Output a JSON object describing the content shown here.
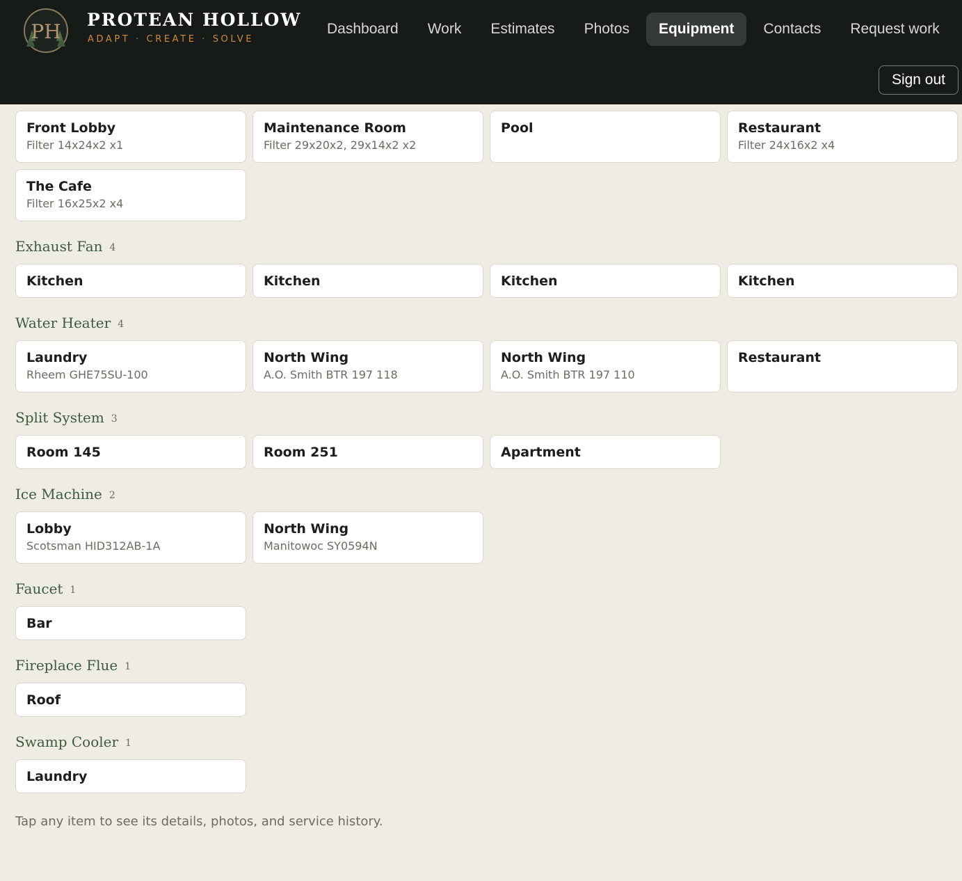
{
  "brand": {
    "name": "PROTEAN HOLLOW",
    "tagline": "ADAPT · CREATE · SOLVE",
    "logo_letters": "PH"
  },
  "nav": {
    "items": [
      "Dashboard",
      "Work",
      "Estimates",
      "Photos",
      "Equipment",
      "Contacts",
      "Request work"
    ],
    "active": "Equipment",
    "sign_out": "Sign out"
  },
  "top_cards": [
    {
      "title": "Front Lobby",
      "sub": "Filter 14x24x2 x1"
    },
    {
      "title": "Maintenance Room",
      "sub": "Filter 29x20x2, 29x14x2 x2"
    },
    {
      "title": "Pool",
      "sub": ""
    },
    {
      "title": "Restaurant",
      "sub": "Filter 24x16x2 x4"
    },
    {
      "title": "The Cafe",
      "sub": "Filter 16x25x2 x4"
    }
  ],
  "sections": [
    {
      "title": "Exhaust Fan",
      "count": "4",
      "items": [
        {
          "title": "Kitchen",
          "sub": ""
        },
        {
          "title": "Kitchen",
          "sub": ""
        },
        {
          "title": "Kitchen",
          "sub": ""
        },
        {
          "title": "Kitchen",
          "sub": ""
        }
      ]
    },
    {
      "title": "Water Heater",
      "count": "4",
      "items": [
        {
          "title": "Laundry",
          "sub": "Rheem GHE75SU-100"
        },
        {
          "title": "North Wing",
          "sub": "A.O. Smith BTR 197 118"
        },
        {
          "title": "North Wing",
          "sub": "A.O. Smith BTR 197 110"
        },
        {
          "title": "Restaurant",
          "sub": ""
        }
      ]
    },
    {
      "title": "Split System",
      "count": "3",
      "items": [
        {
          "title": "Room 145",
          "sub": ""
        },
        {
          "title": "Room 251",
          "sub": ""
        },
        {
          "title": "Apartment",
          "sub": ""
        }
      ]
    },
    {
      "title": "Ice Machine",
      "count": "2",
      "items": [
        {
          "title": "Lobby",
          "sub": "Scotsman HID312AB-1A"
        },
        {
          "title": "North Wing",
          "sub": "Manitowoc SY0594N"
        }
      ]
    },
    {
      "title": "Faucet",
      "count": "1",
      "items": [
        {
          "title": "Bar",
          "sub": ""
        }
      ]
    },
    {
      "title": "Fireplace Flue",
      "count": "1",
      "items": [
        {
          "title": "Roof",
          "sub": ""
        }
      ]
    },
    {
      "title": "Swamp Cooler",
      "count": "1",
      "items": [
        {
          "title": "Laundry",
          "sub": ""
        }
      ]
    }
  ],
  "footnote": "Tap any item to see its details, photos, and service history.",
  "colors": {
    "header_bg": "#161b18",
    "page_bg": "#efece4",
    "accent": "#d08a3e",
    "section_title": "#3e5a3e"
  }
}
